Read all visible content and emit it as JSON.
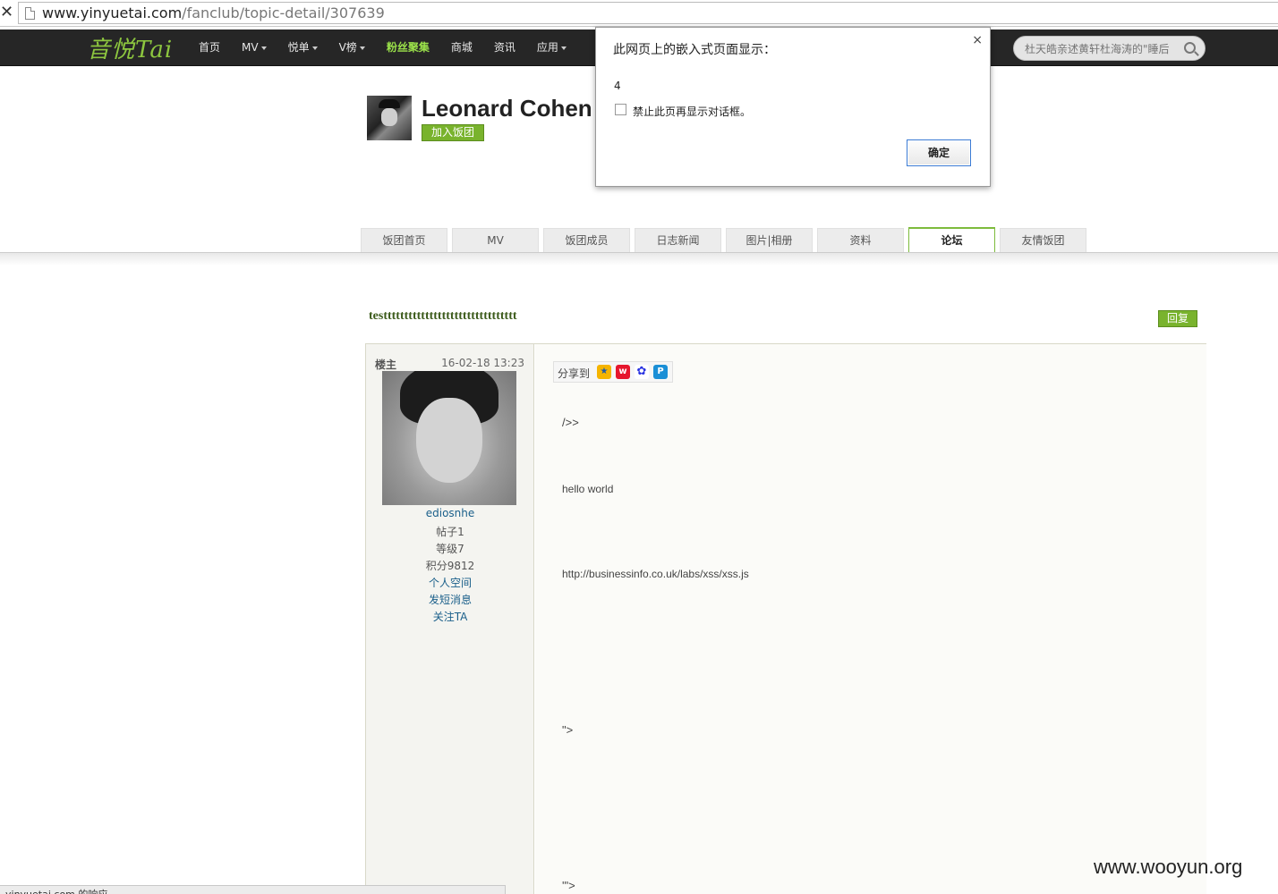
{
  "browser": {
    "url_host": "www.yinyuetai.com",
    "url_path": "/fanclub/topic-detail/307639",
    "back_glyph": "✕"
  },
  "site": {
    "logo": "音悦Tai",
    "nav": [
      {
        "label": "首页",
        "caret": false
      },
      {
        "label": "MV",
        "caret": true
      },
      {
        "label": "悦单",
        "caret": true
      },
      {
        "label": "V榜",
        "caret": true
      },
      {
        "label": "粉丝聚集",
        "caret": false,
        "highlight": true
      },
      {
        "label": "商城",
        "caret": false
      },
      {
        "label": "资讯",
        "caret": false
      },
      {
        "label": "应用",
        "caret": true
      }
    ],
    "search_placeholder": "杜天皓亲述黄轩杜海涛的\"睡后",
    "accent_color": "#79b32d"
  },
  "fanclub": {
    "name": "Leonard Cohen",
    "join_label": "加入饭团",
    "tabs": [
      {
        "label": "饭团首页",
        "active": false
      },
      {
        "label": "MV",
        "active": false
      },
      {
        "label": "饭团成员",
        "active": false
      },
      {
        "label": "日志新闻",
        "active": false
      },
      {
        "label": "图片|相册",
        "active": false
      },
      {
        "label": "资料",
        "active": false
      },
      {
        "label": "论坛",
        "active": true
      },
      {
        "label": "友情饭团",
        "active": false
      }
    ]
  },
  "topic": {
    "title": "testttttttttttttttttttttttttttttttt",
    "reply_label": "回复"
  },
  "post": {
    "floor_label": "楼主",
    "time": "16-02-18 13:23",
    "user": {
      "name": "ediosnhe",
      "posts": "帖子1",
      "level": "等级7",
      "points": "积分9812",
      "links": [
        "个人空间",
        "发短消息",
        "关注TA"
      ]
    },
    "share_label": "分享到",
    "share_icons": [
      "qzone-icon",
      "weibo-icon",
      "baidu-icon",
      "pengyou-icon"
    ],
    "lines": [
      "/>>",
      "hello world",
      "http://businessinfo.co.uk/labs/xss/xss.js",
      "\">",
      "'\">"
    ]
  },
  "dialog": {
    "title": "此网页上的嵌入式页面显示：",
    "message": "4",
    "checkbox_label": "禁止此页再显示对话框。",
    "ok_label": "确定",
    "close_glyph": "×"
  },
  "status_text": "yinyuetai.com 的响应...",
  "watermark": "www.wooyun.org"
}
